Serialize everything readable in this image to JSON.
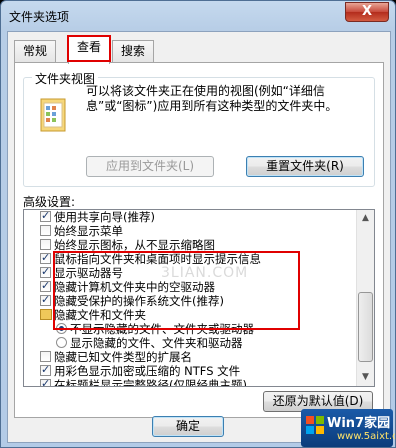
{
  "window": {
    "title": "文件夹选项",
    "close_label": "X"
  },
  "tabs": [
    {
      "label": "常规"
    },
    {
      "label": "查看"
    },
    {
      "label": "搜索"
    }
  ],
  "folder_views": {
    "group_label": "文件夹视图",
    "description": "可以将该文件夹正在使用的视图(例如“详细信息”或“图标”)应用到所有这种类型的文件夹中。",
    "apply_button": "应用到文件夹(L)",
    "reset_button": "重置文件夹(R)"
  },
  "advanced": {
    "label": "高级设置:",
    "items": [
      {
        "kind": "check",
        "checked": true,
        "label": "使用共享向导(推荐)"
      },
      {
        "kind": "check",
        "checked": false,
        "label": "始终显示菜单"
      },
      {
        "kind": "check",
        "checked": false,
        "label": "始终显示图标，从不显示缩略图"
      },
      {
        "kind": "check",
        "checked": true,
        "label": "鼠标指向文件夹和桌面项时显示提示信息"
      },
      {
        "kind": "check",
        "checked": true,
        "label": "显示驱动器号"
      },
      {
        "kind": "check",
        "checked": true,
        "label": "隐藏计算机文件夹中的空驱动器"
      },
      {
        "kind": "check",
        "checked": true,
        "label": "隐藏受保护的操作系统文件(推荐)"
      },
      {
        "kind": "folder",
        "label": "隐藏文件和文件夹"
      },
      {
        "kind": "radio",
        "checked": true,
        "label": "不显示隐藏的文件、文件夹或驱动器"
      },
      {
        "kind": "radio",
        "checked": false,
        "label": "显示隐藏的文件、文件夹和驱动器"
      },
      {
        "kind": "check",
        "checked": false,
        "label": "隐藏已知文件类型的扩展名"
      },
      {
        "kind": "check",
        "checked": true,
        "label": "用彩色显示加密或压缩的 NTFS 文件"
      },
      {
        "kind": "check",
        "checked": true,
        "label": "在标题栏显示完整路径(仅限经典主题)"
      }
    ]
  },
  "restore_button": "还原为默认值(D)",
  "ok_button": "确定",
  "watermark": "3LIAN.COM",
  "logo": {
    "title": "Win7家园",
    "url": "www.5aixt.com"
  }
}
